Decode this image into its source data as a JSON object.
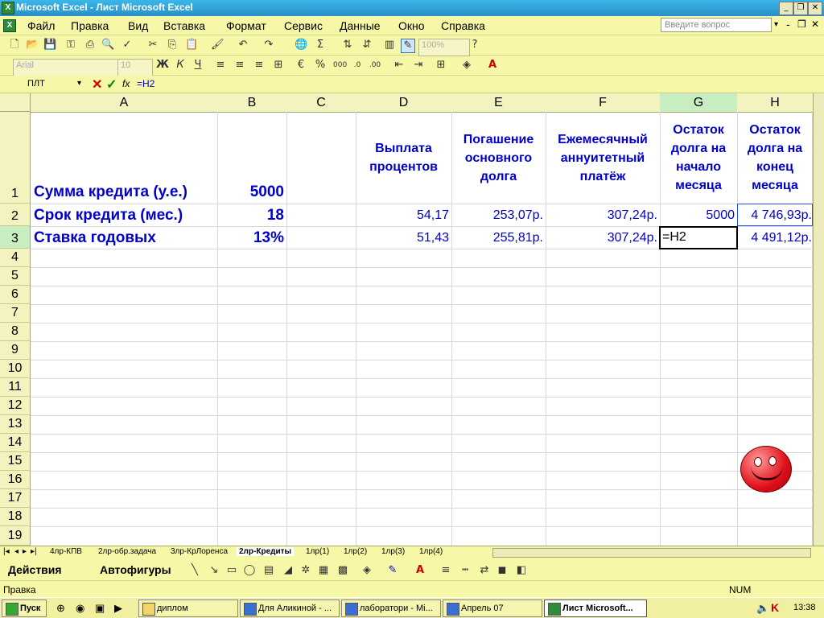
{
  "window": {
    "title": "Microsoft Excel - Лист Microsoft Excel"
  },
  "menu": [
    "Файл",
    "Правка",
    "Вид",
    "Вставка",
    "Формат",
    "Сервис",
    "Данные",
    "Окно",
    "Справка"
  ],
  "ask_placeholder": "Введите вопрос",
  "zoom": "100%",
  "font_combo": "Arial",
  "size_combo": "10",
  "namebox": "ПЛТ",
  "formula": "=H2",
  "columns": [
    "A",
    "B",
    "C",
    "D",
    "E",
    "F",
    "G",
    "H"
  ],
  "rows": [
    "1",
    "2",
    "3",
    "4",
    "5",
    "6",
    "7",
    "8",
    "9",
    "10",
    "11",
    "12",
    "13",
    "14",
    "15",
    "16",
    "17",
    "18",
    "19"
  ],
  "cells": {
    "A1": "Сумма кредита (у.е.)",
    "B1": "5000",
    "D1": "Выплата процентов",
    "E1": "Погашение основного долга",
    "F1": "Ежемесячный аннуитетный платёж",
    "G1": "Остаток долга на начало месяца",
    "H1": "Остаток долга на конец месяца",
    "A2": "Срок кредита (мес.)",
    "B2": "18",
    "D2": "54,17",
    "E2": "253,07р.",
    "F2": "307,24р.",
    "G2": "5000",
    "H2": "4 746,93р.",
    "A3": "Ставка годовых",
    "B3": "13%",
    "D3": "51,43",
    "E3": "255,81р.",
    "F3": "307,24р.",
    "G3": "=H2",
    "H3": "4 491,12р."
  },
  "sheet_tabs": [
    "4лр-КПВ",
    "2лр-обр.задача",
    "3лр-КрЛоренса",
    "2лр-Кредиты",
    "1лр(1)",
    "1лр(2)",
    "1лр(3)",
    "1лр(4)"
  ],
  "active_tab": "2лр-Кредиты",
  "draw": {
    "actions": "Действия",
    "autoshapes": "Автофигуры"
  },
  "status": {
    "left": "Правка",
    "num": "NUM"
  },
  "taskbar": {
    "start": "Пуск",
    "items": [
      "диплом",
      "Для Аликиной - ...",
      "лаборатори - Mi...",
      "Апрель 07",
      "Лист Microsoft..."
    ],
    "clock": "13:38"
  },
  "colors": {
    "bg": "#f7f7a8",
    "cell_text": "#0000cc",
    "selected_header": "#c8edc0"
  }
}
